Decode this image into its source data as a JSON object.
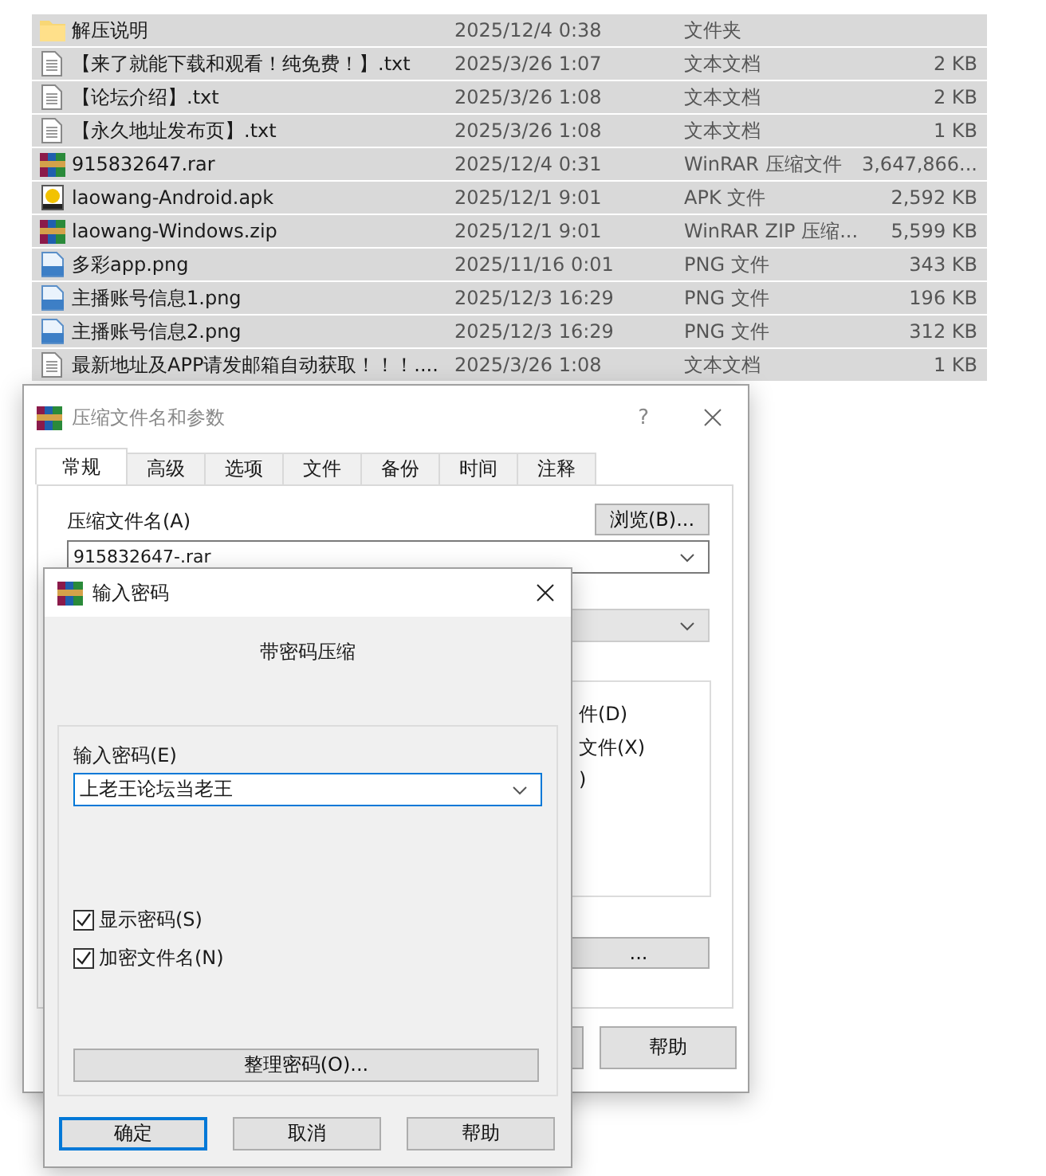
{
  "file_list": {
    "rows": [
      {
        "kind": "folder",
        "name": "解压说明",
        "date": "2025/12/4 0:38",
        "type": "文件夹",
        "selected": true
      },
      {
        "kind": "text",
        "name": "【来了就能下载和观看！纯免费！】.txt",
        "date": "2025/3/26 1:07",
        "type": "文本文档",
        "size": "2 KB",
        "selected": true
      },
      {
        "kind": "text",
        "name": "【论坛介绍】.txt",
        "date": "2025/3/26 1:08",
        "type": "文本文档",
        "size": "2 KB",
        "selected": true
      },
      {
        "kind": "text",
        "name": "【永久地址发布页】.txt",
        "date": "2025/3/26 1:08",
        "type": "文本文档",
        "size": "1 KB",
        "selected": true
      },
      {
        "kind": "rar",
        "name": "915832647.rar",
        "date": "2025/12/4 0:31",
        "type": "WinRAR 压缩文件",
        "size": "3,647,866...",
        "selected": true
      },
      {
        "kind": "apk",
        "name": "laowang-Android.apk",
        "date": "2025/12/1 9:01",
        "type": "APK 文件",
        "size": "2,592 KB",
        "selected": true
      },
      {
        "kind": "rar",
        "name": "laowang-Windows.zip",
        "date": "2025/12/1 9:01",
        "type": "WinRAR ZIP 压缩...",
        "size": "5,599 KB",
        "selected": true
      },
      {
        "kind": "png",
        "name": "多彩app.png",
        "date": "2025/11/16 0:01",
        "type": "PNG 文件",
        "size": "343 KB",
        "selected": true
      },
      {
        "kind": "png",
        "name": "主播账号信息1.png",
        "date": "2025/12/3 16:29",
        "type": "PNG 文件",
        "size": "196 KB",
        "selected": true
      },
      {
        "kind": "png",
        "name": "主播账号信息2.png",
        "date": "2025/12/3 16:29",
        "type": "PNG 文件",
        "size": "312 KB",
        "selected": true
      },
      {
        "kind": "text",
        "name": "最新地址及APP请发邮箱自动获取！！！....",
        "date": "2025/3/26 1:08",
        "type": "文本文档",
        "size": "1 KB",
        "selected": true
      }
    ]
  },
  "archive_dialog": {
    "title": "压缩文件名和参数",
    "help_glyph": "?",
    "tabs": [
      {
        "label": "常规",
        "selected": true
      },
      {
        "label": "高级",
        "selected": false
      },
      {
        "label": "选项",
        "selected": false
      },
      {
        "label": "文件",
        "selected": false
      },
      {
        "label": "备份",
        "selected": false
      },
      {
        "label": "时间",
        "selected": false
      },
      {
        "label": "注释",
        "selected": false
      }
    ],
    "archive_name_label": "压缩文件名(A)",
    "browse_button": "浏览(B)...",
    "archive_name": "915832647-.rar",
    "partial_texts": [
      "件(D)",
      "文件(X)",
      ")"
    ],
    "partial_button": "...",
    "help_button": "帮助"
  },
  "password_dialog": {
    "title": "输入密码",
    "heading": "带密码压缩",
    "password_label": "输入密码(E)",
    "password": "上老王论坛当老王",
    "options": [
      {
        "label": "显示密码(S)",
        "checked": true
      },
      {
        "label": "加密文件名(N)",
        "checked": true
      }
    ],
    "organize_button": "整理密码(O)...",
    "buttons": [
      {
        "label": "确定",
        "default": true
      },
      {
        "label": "取消",
        "default": false
      },
      {
        "label": "帮助",
        "default": false
      }
    ]
  }
}
